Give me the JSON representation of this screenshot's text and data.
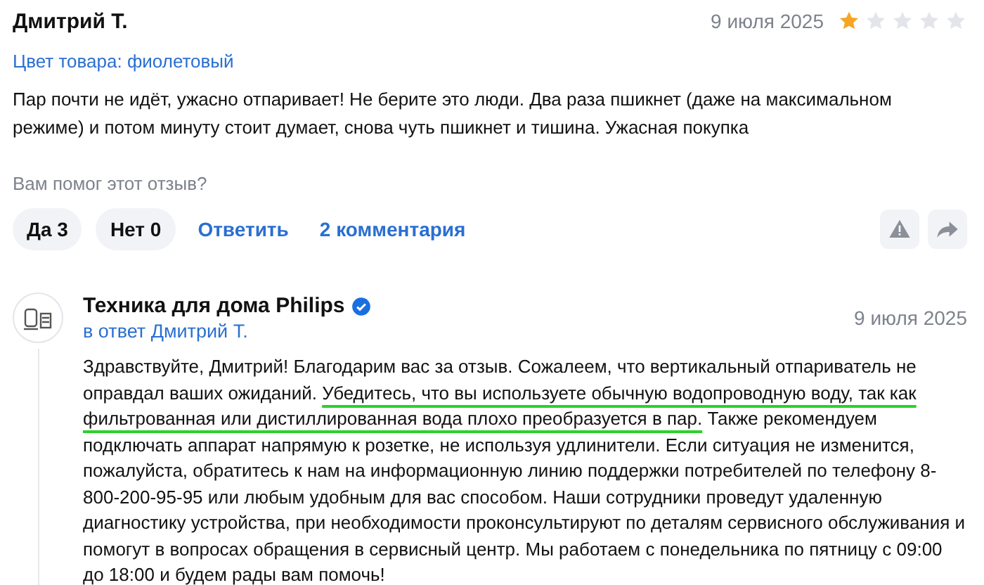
{
  "review": {
    "author": "Дмитрий Т.",
    "date": "9 июля 2025",
    "stars": 1,
    "product_color": "Цвет товара: фиолетовый",
    "text": "Пар почти не идёт, ужасно отпаривает! Не берите это люди. Два раза пшикнет (даже на максимальном режиме) и потом минуту стоит думает, снова чуть пшикнет и тишина. Ужасная покупка",
    "helpful_question": "Вам помог этот отзыв?",
    "votes": [
      {
        "label": "Да 3"
      },
      {
        "label": "Нет 0"
      }
    ],
    "links": [
      "Ответить",
      "2 комментария"
    ]
  },
  "reply": {
    "author": "Техника для дома Philips",
    "verified": true,
    "in_reply_to": "в ответ Дмитрий Т.",
    "date": "9 июля 2025",
    "text_parts": [
      {
        "text": "Здравствуйте, Дмитрий! Благодарим вас за отзыв. Сожалеем, что вертикальный отпариватель не оправдал ваших ожиданий. ",
        "highlighted": false
      },
      {
        "text": "Убедитесь, что вы используете обычную водопроводную воду, так как фильтрованная или дистиллированная вода плохо преобразуется в пар.",
        "highlighted": true
      },
      {
        "text": " Также рекомендуем подключать аппарат напрямую к розетке, не используя удлинители. Если ситуация не изменится, пожалуйста, обратитесь к нам на информационную линию поддержки потребителей по телефону 8-800-200-95-95 или любым удобным для вас способом. Наши сотрудники проведут удаленную диагностику устройства, при необходимости проконсультируют по деталям сервисного обслуживания и помогут в вопросах обращения в сервисный центр. Мы работаем с понедельника по пятницу с 09:00 до 18:00 и будем рады вам помочь!",
        "highlighted": false
      }
    ]
  }
}
